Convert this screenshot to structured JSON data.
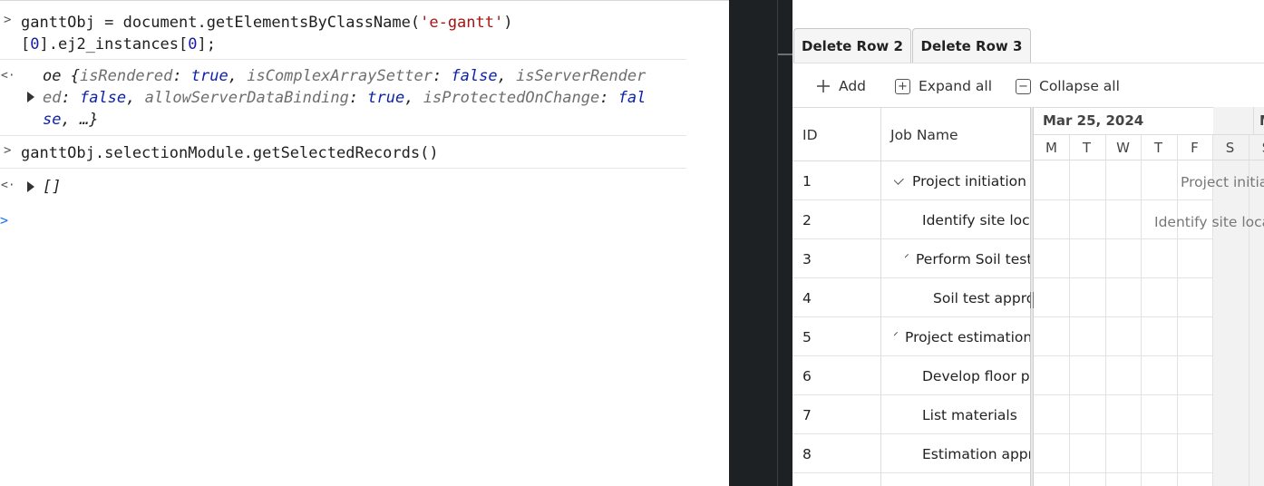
{
  "console": {
    "entries": [
      {
        "type": "input",
        "line1_a": "ganttObj = document.getElementsByClassName(",
        "line1_str": "'e-gantt'",
        "line1_b": ")",
        "line2_a": "[",
        "line2_n1": "0",
        "line2_b": "].ej2_instances[",
        "line2_n2": "0",
        "line2_c": "];"
      },
      {
        "type": "output",
        "l1_prefix": "oe {",
        "l1_k1": "isRendered",
        "l1_v1": "true",
        "l1_k2": "isComplexArraySetter",
        "l1_v2": "false",
        "l1_k3": "isServerRender",
        "l2_k3b": "ed",
        "l2_v3": "false",
        "l2_k4": "allowServerDataBinding",
        "l2_v4": "true",
        "l2_k5": "isProtectedOnChange",
        "l2_v5a": "fal",
        "l3_v5b": "se",
        "l3_tail": ", …}"
      },
      {
        "type": "input",
        "text": "ganttObj.selectionModule.getSelectedRecords()"
      },
      {
        "type": "output",
        "text": "[]"
      }
    ]
  },
  "gantt": {
    "buttons": [
      "Delete Row 2",
      "Delete Row 3"
    ],
    "toolbar": {
      "add": "Add",
      "expand_all": "Expand all",
      "collapse_all": "Collapse all"
    },
    "columns": {
      "id": "ID",
      "name": "Job Name"
    },
    "rows": [
      {
        "id": "1",
        "name": "Project initiation",
        "level": 0,
        "parent": true
      },
      {
        "id": "2",
        "name": "Identify site location",
        "level": 1,
        "parent": false
      },
      {
        "id": "3",
        "name": "Perform Soil test",
        "level": 1,
        "parent": true
      },
      {
        "id": "4",
        "name": "Soil test approval",
        "level": 2,
        "parent": false
      },
      {
        "id": "5",
        "name": "Project estimation",
        "level": 0,
        "parent": true
      },
      {
        "id": "6",
        "name": "Develop floor plan",
        "level": 1,
        "parent": false
      },
      {
        "id": "7",
        "name": "List materials",
        "level": 1,
        "parent": false
      },
      {
        "id": "8",
        "name": "Estimation approval",
        "level": 1,
        "parent": false
      }
    ],
    "timeline": {
      "week1": "Mar 25, 2024",
      "week2": "M",
      "days": [
        "M",
        "T",
        "W",
        "T",
        "F",
        "S",
        "S"
      ],
      "labels": {
        "row1": "Project initiation",
        "row2": "Identify site location"
      }
    }
  }
}
